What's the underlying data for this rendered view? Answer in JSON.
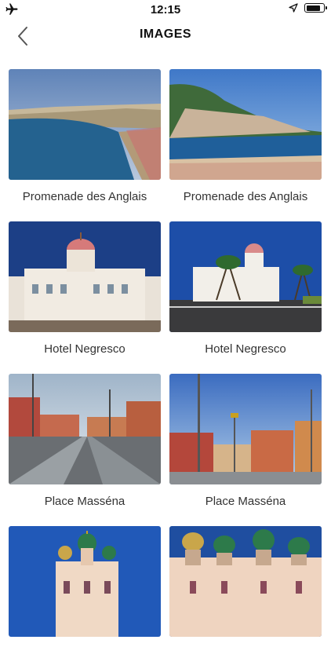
{
  "status_bar": {
    "time": "12:15",
    "battery_level": 0.85
  },
  "header": {
    "title": "IMAGES"
  },
  "images": [
    {
      "caption": "Promenade des Anglais",
      "scene": "bay-coast"
    },
    {
      "caption": "Promenade des Anglais",
      "scene": "beach-hill"
    },
    {
      "caption": "Hotel Negresco",
      "scene": "negresco-front"
    },
    {
      "caption": "Hotel Negresco",
      "scene": "negresco-street"
    },
    {
      "caption": "Place Masséna",
      "scene": "massena-square"
    },
    {
      "caption": "Place Masséna",
      "scene": "massena-buildings"
    },
    {
      "caption": "",
      "scene": "cathedral-left"
    },
    {
      "caption": "",
      "scene": "cathedral-right"
    }
  ],
  "colors": {
    "sky": "#3f6fc4",
    "sea": "#2f6fa6",
    "text": "#333333"
  }
}
